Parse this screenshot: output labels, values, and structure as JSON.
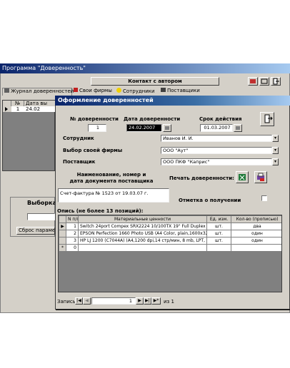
{
  "back": {
    "title": "Программа \"Доверенность\"",
    "contact_button": "Контакт с автором",
    "tabs": [
      "Журнал доверенностей",
      "Свои фирмы",
      "Сотрудники",
      "Поставщики"
    ],
    "table_headers": [
      "№",
      "Дата вы"
    ],
    "table_row": [
      "1",
      "24.02"
    ],
    "group_label": "Выборка",
    "reset_button": "Сброс парамет"
  },
  "front": {
    "title": "Оформление доверенностей",
    "labels": {
      "number": "№ доверенности",
      "date": "Дата доверенности",
      "validity": "Срок действия",
      "employee": "Сотрудник",
      "firm": "Выбор своей фирмы",
      "supplier": "Поставщик",
      "doc_label": "Наименование, номер и дата документа поставщика",
      "print": "Печать доверенности:",
      "received": "Отметка о получении",
      "inventory": "Опись (не более 13 позиций):"
    },
    "values": {
      "number": "1",
      "date": "24.02.2007",
      "validity": "01.03.2007",
      "employee": "Иванов И. И.",
      "firm": "ООО \"Аут\"",
      "supplier": "ООО ПКФ \"Каприс\"",
      "doc": "Счет-фактура № 1523 от 19.03.07 г."
    },
    "grid": {
      "headers": [
        "N п/п",
        "Материальные ценности",
        "Ед. изм.",
        "Кол-во (прописью)"
      ],
      "rows": [
        {
          "n": "1",
          "item": "Switch 24port Compex SRX2224 10/100TX 19\" Full Duplex",
          "unit": "шт.",
          "qty": "два"
        },
        {
          "n": "2",
          "item": "EPSON Perfection 1660 Photo USB (A4 Color, plain,1600x320",
          "unit": "шт.",
          "qty": "один"
        },
        {
          "n": "3",
          "item": "HP LJ 1200 (C7044A) (A4,1200 dpi,14 стр/мин, 8 mb, LPT, U:",
          "unit": "шт.",
          "qty": "один"
        },
        {
          "n": "0",
          "item": "",
          "unit": "",
          "qty": ""
        }
      ]
    },
    "nav": {
      "label": "Запись:",
      "current": "1",
      "total_label": "из 1"
    }
  }
}
